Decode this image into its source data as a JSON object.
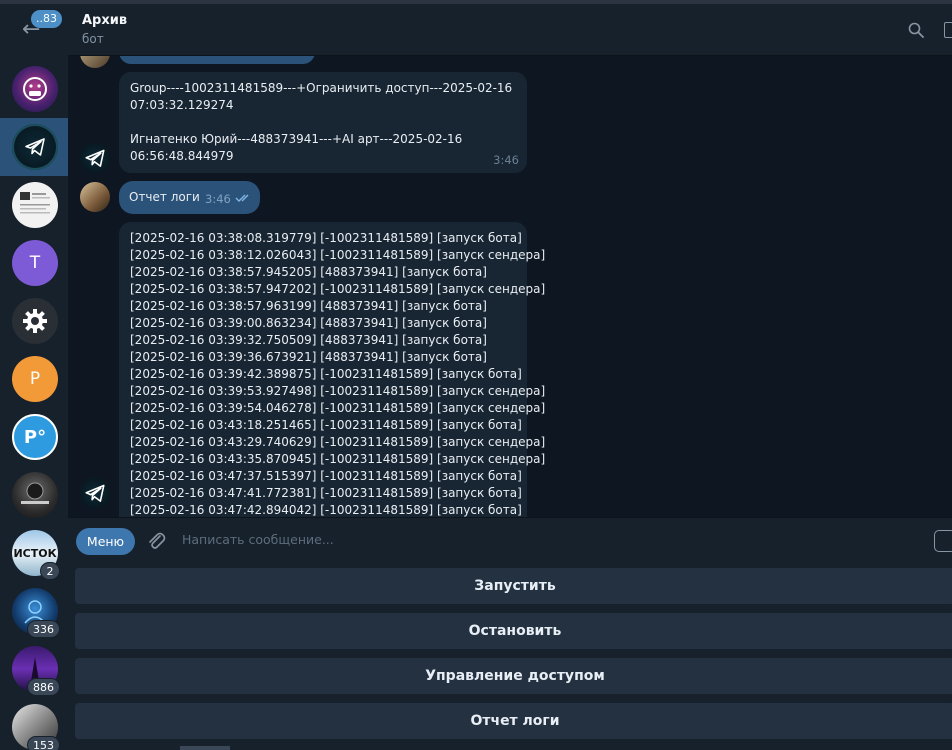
{
  "header": {
    "title": "Архив",
    "subtitle": "бот"
  },
  "sidebar": {
    "back_badge": "..83",
    "chats": [
      {
        "initial": "",
        "count": ""
      },
      {
        "initial": "",
        "count": ""
      },
      {
        "initial": "",
        "count": ""
      },
      {
        "initial": "T",
        "count": ""
      },
      {
        "initial": "",
        "count": ""
      },
      {
        "initial": "P",
        "count": ""
      },
      {
        "initial": "P°",
        "count": ""
      },
      {
        "initial": "",
        "count": ""
      },
      {
        "initial": "ИСТОК",
        "count": "2"
      },
      {
        "initial": "",
        "count": "336"
      },
      {
        "initial": "",
        "count": "886"
      },
      {
        "initial": "",
        "count": "153"
      }
    ]
  },
  "messages": [
    {
      "direction": "in",
      "lines": [
        "Group----1002311481589---+Ограничить доступ---2025-02-16",
        "07:03:32.129274",
        "",
        "Игнатенко Юрий---488373941---+AI арт---2025-02-16",
        "06:56:48.844979"
      ],
      "time": "3:46"
    },
    {
      "direction": "out",
      "text": "Отчет логи",
      "time": "3:46"
    },
    {
      "direction": "in",
      "lines": [
        "[2025-02-16 03:38:08.319779] [-1002311481589] [запуск бота]",
        "[2025-02-16 03:38:12.026043] [-1002311481589] [запуск сендера]",
        "[2025-02-16 03:38:57.945205] [488373941] [запуск бота]",
        "[2025-02-16 03:38:57.947202] [-1002311481589] [запуск сендера]",
        "[2025-02-16 03:38:57.963199] [488373941] [запуск бота]",
        "[2025-02-16 03:39:00.863234] [488373941] [запуск бота]",
        "[2025-02-16 03:39:32.750509] [488373941] [запуск бота]",
        "[2025-02-16 03:39:36.673921] [488373941] [запуск бота]",
        "[2025-02-16 03:39:42.389875] [-1002311481589] [запуск бота]",
        "[2025-02-16 03:39:53.927498] [-1002311481589] [запуск сендера]",
        "[2025-02-16 03:39:54.046278] [-1002311481589] [запуск сендера]",
        "[2025-02-16 03:43:18.251465] [-1002311481589] [запуск бота]",
        "[2025-02-16 03:43:29.740629] [-1002311481589] [запуск сендера]",
        "[2025-02-16 03:43:35.870945] [-1002311481589] [запуск сендера]",
        "[2025-02-16 03:47:37.515397] [-1002311481589] [запуск бота]",
        "[2025-02-16 03:47:41.772381] [-1002311481589] [запуск бота]",
        "[2025-02-16 03:47:42.894042] [-1002311481589] [запуск бота]"
      ]
    }
  ],
  "composer": {
    "menu_label": "Меню",
    "placeholder": "Написать сообщение..."
  },
  "keyboard": {
    "buttons": [
      "Запустить",
      "Остановить",
      "Управление доступом",
      "Отчет логи"
    ]
  },
  "colors": {
    "background": "#0e1621",
    "panel": "#17212b",
    "bubble_in": "#182533",
    "bubble_out": "#2b5278",
    "accent": "#3d77ae"
  }
}
